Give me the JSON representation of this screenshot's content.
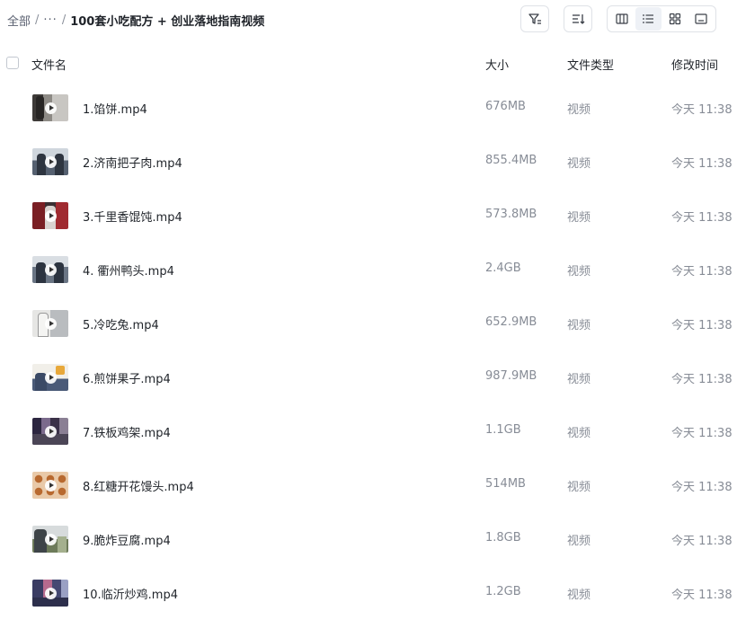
{
  "breadcrumb": {
    "root": "全部",
    "separator": "/",
    "more": "···",
    "current": "100套小吃配方 + 创业落地指南视频"
  },
  "toolbar": {
    "icons": [
      "filter-icon",
      "sort-icon",
      "column-view-icon",
      "list-view-icon",
      "grid-view-icon",
      "preview-view-icon"
    ],
    "active_view": "list"
  },
  "table": {
    "columns": {
      "name": "文件名",
      "size": "大小",
      "type": "文件类型",
      "modified": "修改时间"
    },
    "rows": [
      {
        "name": "1.馅饼.mp4",
        "size": "676MB",
        "type": "视频",
        "modified": "今天 11:38",
        "thumb": "video-thumbnail"
      },
      {
        "name": "2.济南把子肉.mp4",
        "size": "855.4MB",
        "type": "视频",
        "modified": "今天 11:38",
        "thumb": "video-thumbnail"
      },
      {
        "name": "3.千里香馄饨.mp4",
        "size": "573.8MB",
        "type": "视频",
        "modified": "今天 11:38",
        "thumb": "video-thumbnail"
      },
      {
        "name": "4. 衢州鸭头.mp4",
        "size": "2.4GB",
        "type": "视频",
        "modified": "今天 11:38",
        "thumb": "video-thumbnail"
      },
      {
        "name": "5.冷吃兔.mp4",
        "size": "652.9MB",
        "type": "视频",
        "modified": "今天 11:38",
        "thumb": "video-thumbnail"
      },
      {
        "name": "6.煎饼果子.mp4",
        "size": "987.9MB",
        "type": "视频",
        "modified": "今天 11:38",
        "thumb": "video-thumbnail"
      },
      {
        "name": "7.铁板鸡架.mp4",
        "size": "1.1GB",
        "type": "视频",
        "modified": "今天 11:38",
        "thumb": "video-thumbnail"
      },
      {
        "name": "8.红糖开花馒头.mp4",
        "size": "514MB",
        "type": "视频",
        "modified": "今天 11:38",
        "thumb": "video-thumbnail"
      },
      {
        "name": "9.脆炸豆腐.mp4",
        "size": "1.8GB",
        "type": "视频",
        "modified": "今天 11:38",
        "thumb": "video-thumbnail"
      },
      {
        "name": "10.临沂炒鸡.mp4",
        "size": "1.2GB",
        "type": "视频",
        "modified": "今天 11:38",
        "thumb": "video-thumbnail"
      }
    ]
  },
  "colors": {
    "text_primary": "#1f2329",
    "text_secondary": "#878c96",
    "border": "#dfe2e7",
    "active_view_bg": "#eef1f6"
  }
}
